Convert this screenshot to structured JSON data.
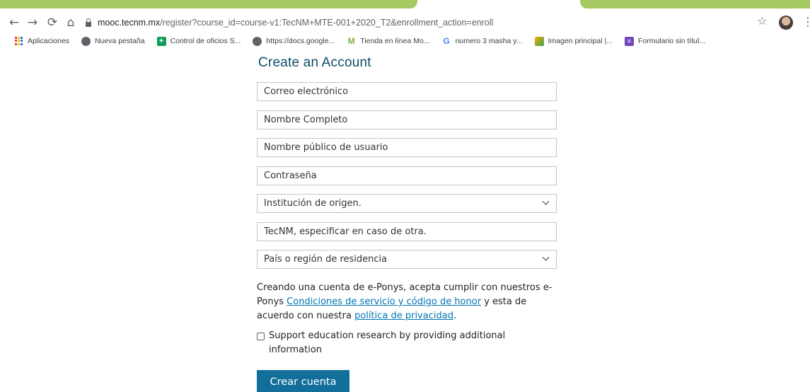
{
  "browser": {
    "url_host": "mooc.tecnm.mx",
    "url_path": "/register?course_id=course-v1:TecNM+MTE-001+2020_T2&enrollment_action=enroll",
    "bookmarks": [
      {
        "label": "Aplicaciones",
        "icon": "apps-grid-icon"
      },
      {
        "label": "Nueva pestaña",
        "icon": "globe-icon"
      },
      {
        "label": "Control de oficios S...",
        "icon": "sheets-plus-icon"
      },
      {
        "label": "https://docs.google...",
        "icon": "globe-icon"
      },
      {
        "label": "Tienda en línea Mo...",
        "icon": "store-logo-icon"
      },
      {
        "label": "numero 3 masha y...",
        "icon": "google-g-icon"
      },
      {
        "label": "Imagen principal |...",
        "icon": "image-icon"
      },
      {
        "label": "Formulario sin títul...",
        "icon": "forms-icon"
      }
    ]
  },
  "form": {
    "title": "Create an Account",
    "email_placeholder": "Correo electrónico",
    "fullname_placeholder": "Nombre Completo",
    "username_placeholder": "Nombre público de usuario",
    "password_placeholder": "Contraseña",
    "institution_selected": "Institución de origen.",
    "other_institution_placeholder": "TecNM, especificar en caso de otra.",
    "country_selected": "País o región de residencia",
    "terms_prefix": "Creando una cuenta de e-Ponys, acepta cumplir con nuestros e-Ponys ",
    "terms_link": "Condiciones de servicio y código de honor",
    "terms_middle": " y esta de acuerdo con nuestra ",
    "privacy_link": "política de privacidad",
    "terms_suffix": ".",
    "research_label": "Support education research by providing additional information",
    "submit_label": "Crear cuenta"
  },
  "colors": {
    "tab_accent": "#a6c964",
    "title": "#0e4d6b",
    "link": "#0075b4",
    "button": "#126f9a"
  }
}
